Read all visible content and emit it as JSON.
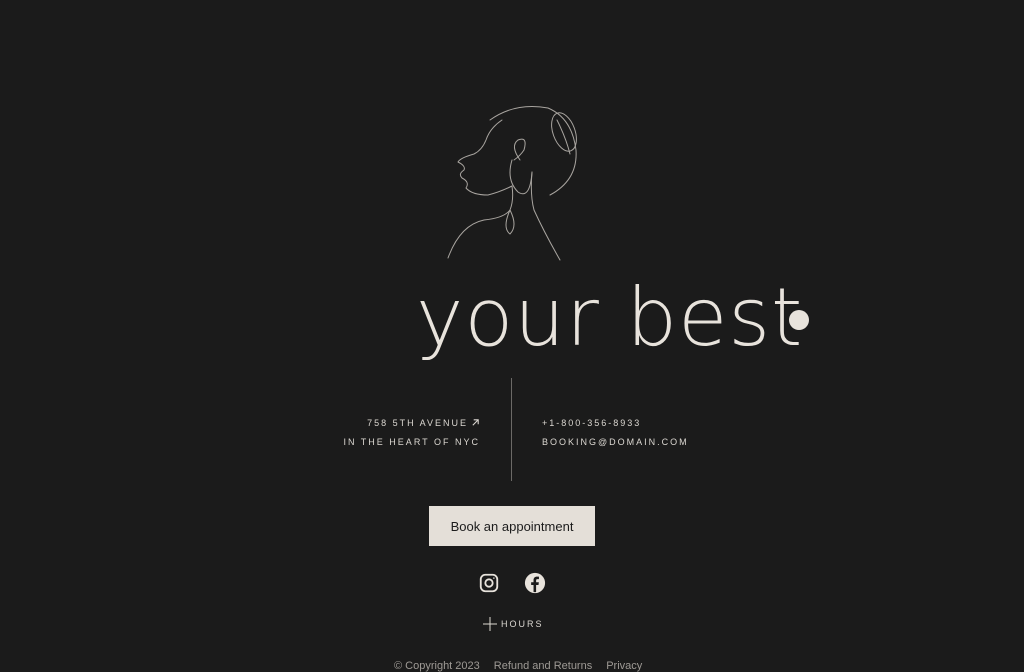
{
  "brand": {
    "logo_icon": "woman-profile-line-art-icon",
    "headline": "your best"
  },
  "address": {
    "line1": "758 5TH AVENUE",
    "line2": "IN THE HEART OF NYC",
    "arrow_icon": "arrow-up-right-icon"
  },
  "contact": {
    "phone": "+1-800-356-8933",
    "email": "BOOKING@DOMAIN.COM"
  },
  "cta": {
    "book_label": "Book an appointment"
  },
  "social": {
    "instagram_icon": "instagram-icon",
    "facebook_icon": "facebook-icon"
  },
  "hours": {
    "label": "HOURS",
    "icon": "plus-icon"
  },
  "footer": {
    "copyright": "© Copyright 2023",
    "refund": "Refund and Returns",
    "privacy": "Privacy"
  },
  "colors": {
    "background": "#1b1b1b",
    "foreground": "#e8e3dc",
    "button_bg": "#e4dfd8",
    "button_text": "#1c1c1c",
    "muted": "#9e9a95"
  }
}
